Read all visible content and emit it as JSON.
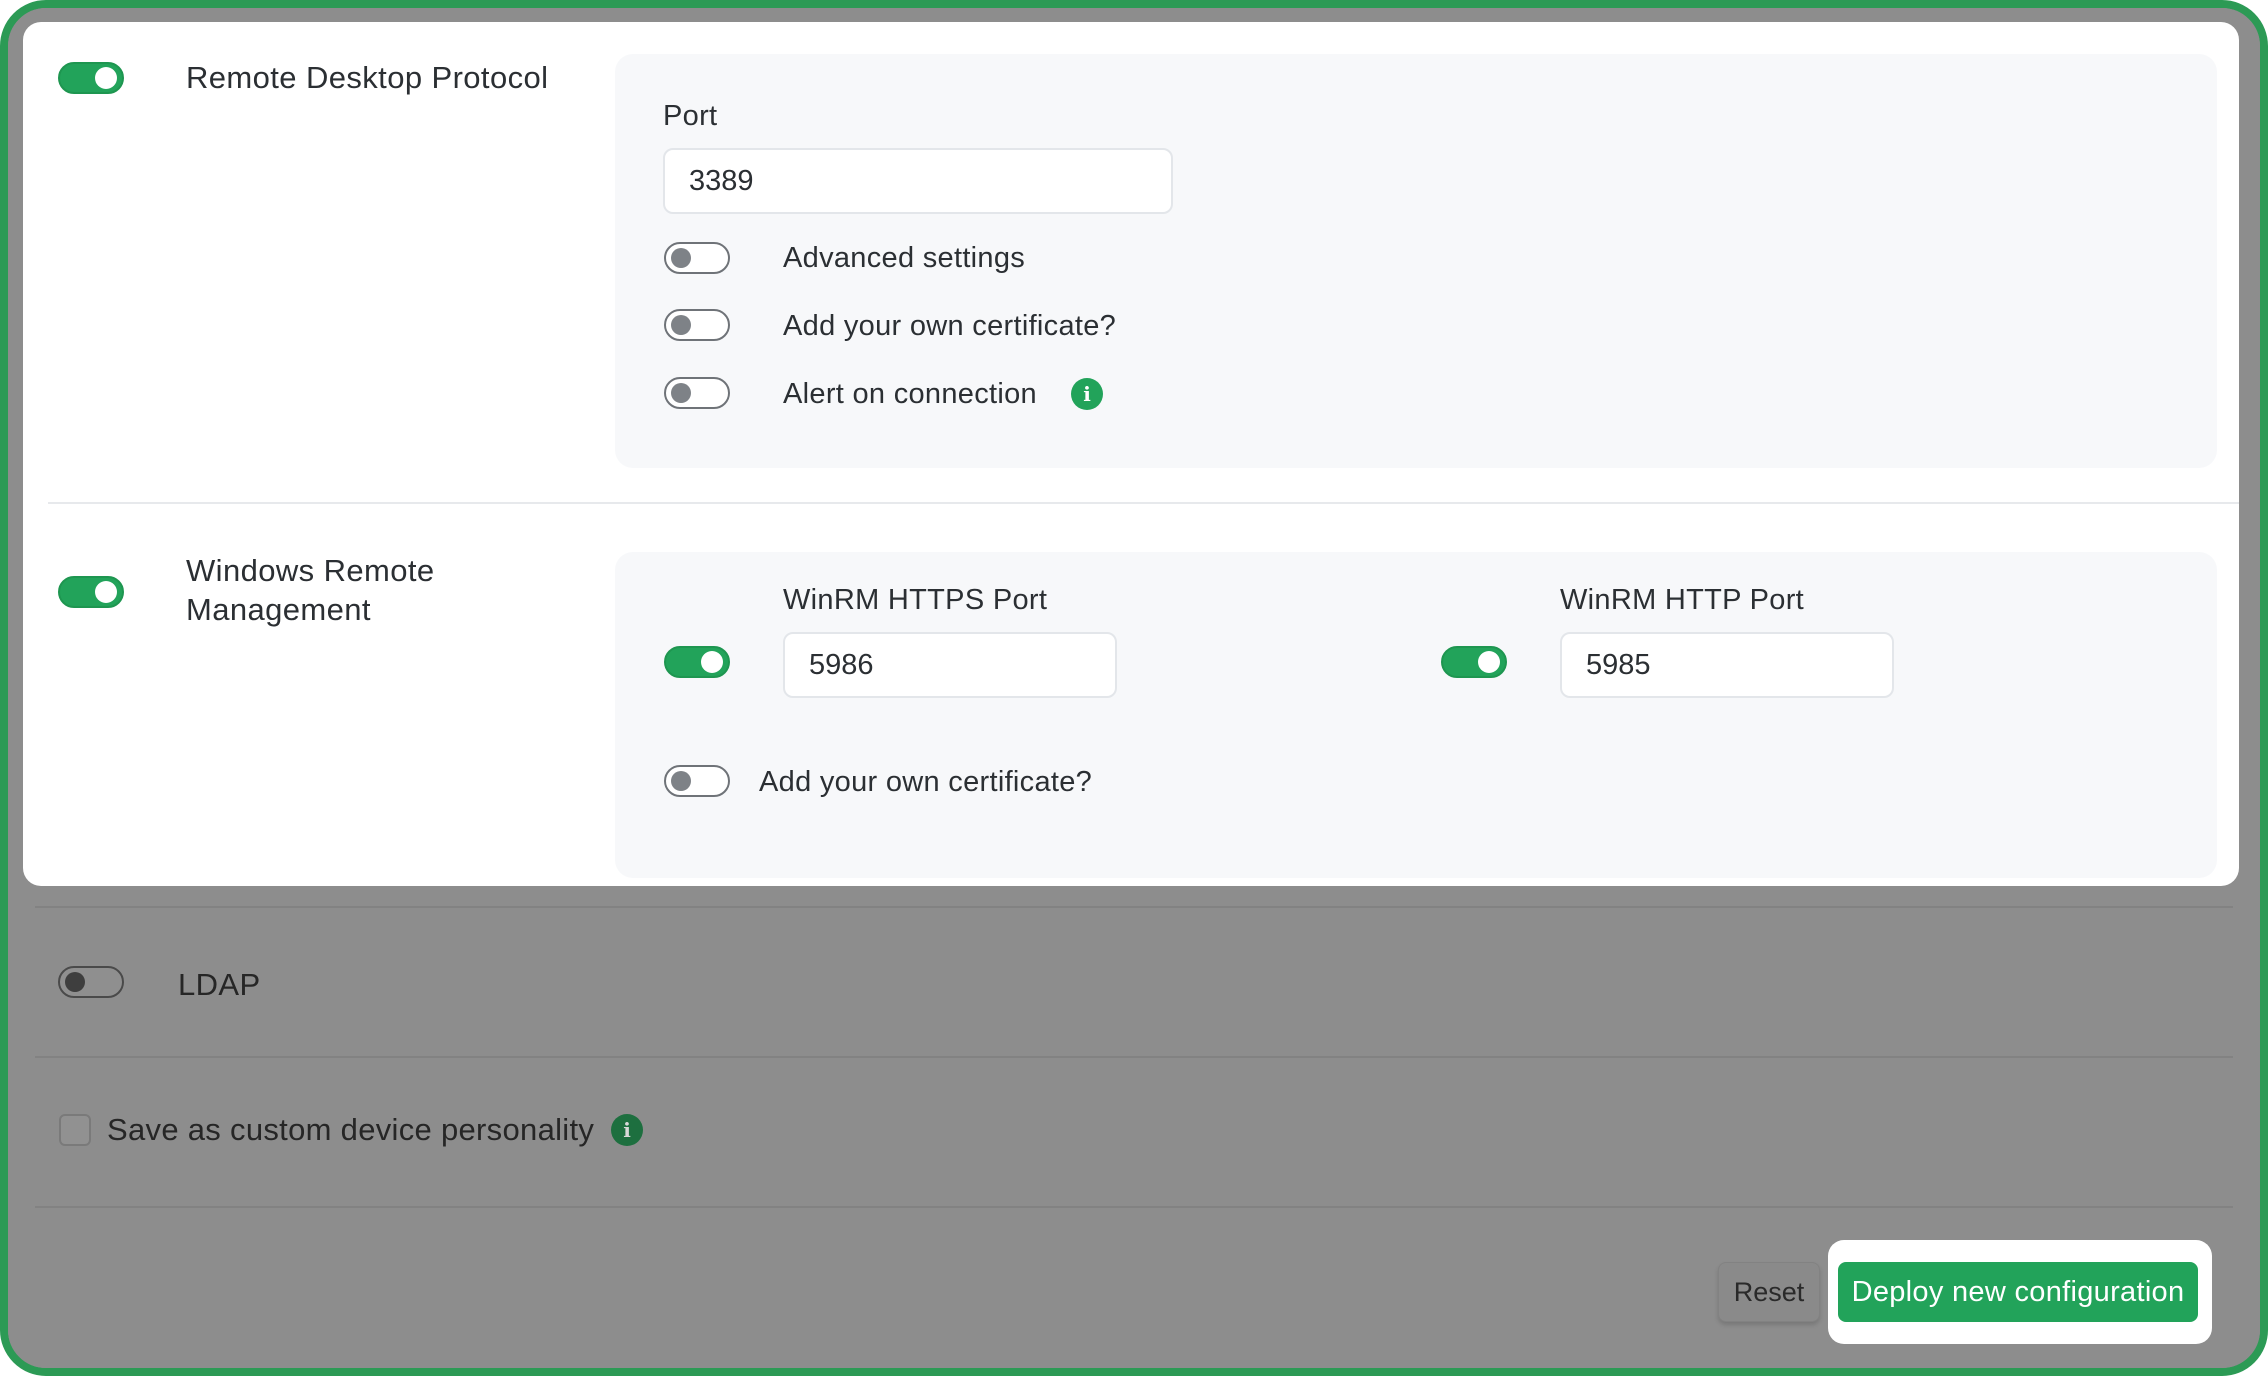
{
  "rdp": {
    "title": "Remote Desktop Protocol",
    "enabled": true,
    "port_label": "Port",
    "port_value": "3389",
    "options": [
      {
        "label": "Advanced settings",
        "enabled": false
      },
      {
        "label": "Add your own certificate?",
        "enabled": false
      },
      {
        "label": "Alert on connection",
        "enabled": false
      }
    ]
  },
  "winrm": {
    "title_line1": "Windows Remote",
    "title_line2": "Management",
    "enabled": true,
    "https_label": "WinRM HTTPS Port",
    "https_value": "5986",
    "https_enabled": true,
    "http_label": "WinRM HTTP Port",
    "http_value": "5985",
    "http_enabled": true,
    "cert_label": "Add your own certificate?",
    "cert_enabled": false
  },
  "ldap": {
    "title": "LDAP",
    "enabled": false
  },
  "personality": {
    "label": "Save as custom device personality",
    "checked": false
  },
  "actions": {
    "reset_label": "Reset",
    "deploy_label": "Deploy new configuration"
  },
  "colors": {
    "accent": "#22a35a",
    "frame_border": "#2c9a55",
    "overlay": "#8d8d8d",
    "panel": "#f7f8fa"
  },
  "icons": {
    "info": "info-icon",
    "toggle": "toggle-switch"
  }
}
